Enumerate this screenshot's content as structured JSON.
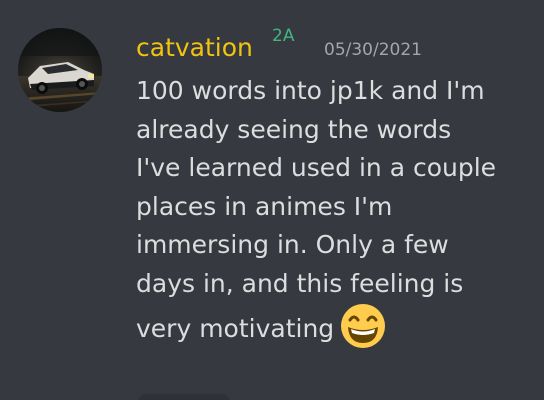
{
  "message": {
    "author": "catvation",
    "role_tag": "2A",
    "timestamp": "05/30/2021",
    "lines": [
      "100 words into jp1k and I'm",
      "already seeing the words",
      "I've learned used in a couple",
      "places in animes I'm",
      "immersing in. Only a few",
      "days in, and this feeling is",
      "very motivating"
    ],
    "emoji": "grinning-face-smiling-eyes"
  },
  "colors": {
    "background": "#36393f",
    "username": "#f1c40f",
    "role_tag": "#43b581",
    "timestamp": "#a3a6aa",
    "text": "#dcddde"
  }
}
